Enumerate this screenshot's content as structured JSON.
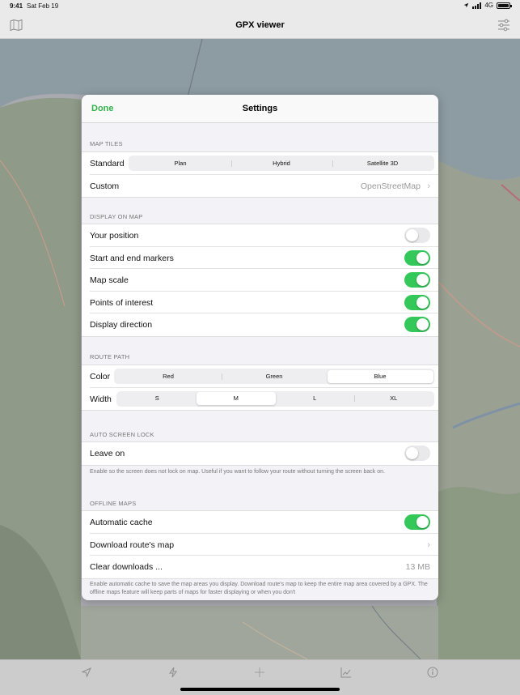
{
  "status_bar": {
    "time": "9:41",
    "date": "Sat Feb 19",
    "network": "4G",
    "battery_level": 1.0
  },
  "nav": {
    "title": "GPX viewer",
    "left_icon": "map-icon",
    "right_icon": "sliders-icon"
  },
  "sheet": {
    "done_label": "Done",
    "title": "Settings",
    "map_tiles": {
      "header": "MAP TILES",
      "standard_label": "Standard",
      "standard_options": [
        "Plan",
        "Hybrid",
        "Satellite 3D"
      ],
      "standard_selected": "",
      "custom_label": "Custom",
      "custom_value": "OpenStreetMap"
    },
    "display": {
      "header": "DISPLAY ON MAP",
      "items": [
        {
          "label": "Your position",
          "on": false
        },
        {
          "label": "Start and end markers",
          "on": true
        },
        {
          "label": "Map scale",
          "on": true
        },
        {
          "label": "Points of interest",
          "on": true
        },
        {
          "label": "Display direction",
          "on": true
        }
      ]
    },
    "route_path": {
      "header": "ROUTE PATH",
      "color_label": "Color",
      "color_options": [
        "Red",
        "Green",
        "Blue"
      ],
      "color_selected": "Blue",
      "width_label": "Width",
      "width_options": [
        "S",
        "M",
        "L",
        "XL"
      ],
      "width_selected": "M"
    },
    "auto_lock": {
      "header": "AUTO SCREEN LOCK",
      "leave_on_label": "Leave on",
      "leave_on": false,
      "footer": "Enable so the screen does not lock on map. Useful if you want to follow your route without turning the screen back on."
    },
    "offline": {
      "header": "OFFLINE MAPS",
      "auto_cache_label": "Automatic cache",
      "auto_cache": true,
      "download_label": "Download route's map",
      "clear_label": "Clear downloads ...",
      "clear_value": "13 MB",
      "footer": "Enable automatic cache to save the map areas you display. Download route's map to keep the entire map area covered by a GPX. The offline maps feature will keep parts of maps for faster displaying or when you don't"
    }
  },
  "tab_bar": {
    "icons": [
      "location-arrow-icon",
      "bolt-icon",
      "crosshair-icon",
      "chart-icon",
      "info-icon"
    ]
  },
  "colors": {
    "accent": "#34b34a",
    "toggle_on": "#34c759"
  }
}
